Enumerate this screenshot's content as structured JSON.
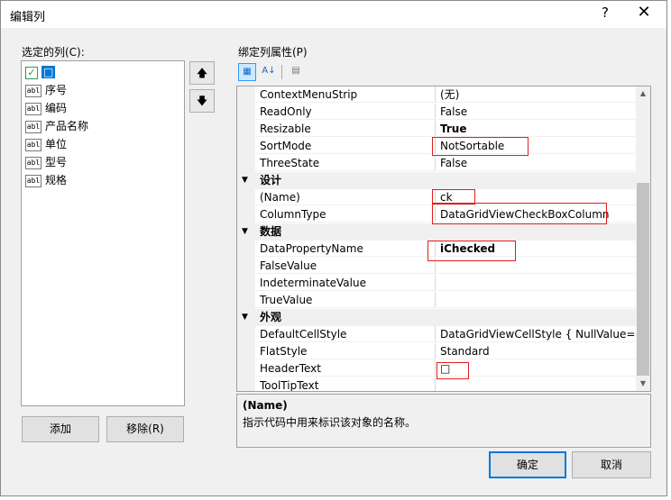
{
  "window": {
    "title": "编辑列",
    "help": "?",
    "close": "✕"
  },
  "columns": {
    "label": "选定的列(C):",
    "items": [
      {
        "icon": "✓",
        "label": "□",
        "selected": true
      },
      {
        "icon": "abl",
        "label": "序号"
      },
      {
        "icon": "abl",
        "label": "编码"
      },
      {
        "icon": "abl",
        "label": "产品名称"
      },
      {
        "icon": "abl",
        "label": "单位"
      },
      {
        "icon": "abl",
        "label": "型号"
      },
      {
        "icon": "abl",
        "label": "规格"
      }
    ],
    "up_icon": "🡅",
    "down_icon": "🡇",
    "add_label": "添加",
    "remove_label": "移除(R)"
  },
  "properties": {
    "label": "绑定列属性(P)",
    "toolbar": {
      "categorized_icon": "▦",
      "alpha_icon": "A↓",
      "pages_icon": "▤"
    },
    "rows": [
      {
        "name": "ContextMenuStrip",
        "value": "(无)"
      },
      {
        "name": "ReadOnly",
        "value": "False"
      },
      {
        "name": "Resizable",
        "value": "True",
        "bold": true
      },
      {
        "name": "SortMode",
        "value": "NotSortable"
      },
      {
        "name": "ThreeState",
        "value": "False"
      }
    ],
    "cat_design": "设计",
    "design_rows": [
      {
        "name": "(Name)",
        "value": "ck"
      },
      {
        "name": "ColumnType",
        "value": "DataGridViewCheckBoxColumn"
      }
    ],
    "cat_data": "数据",
    "data_rows": [
      {
        "name": "DataPropertyName",
        "value": "iChecked",
        "bold": true
      },
      {
        "name": "FalseValue",
        "value": ""
      },
      {
        "name": "IndeterminateValue",
        "value": ""
      },
      {
        "name": "TrueValue",
        "value": ""
      }
    ],
    "cat_appearance": "外观",
    "appearance_rows": [
      {
        "name": "DefaultCellStyle",
        "value": "DataGridViewCellStyle { NullValue=Fal"
      },
      {
        "name": "FlatStyle",
        "value": "Standard"
      },
      {
        "name": "HeaderText",
        "value": "□"
      },
      {
        "name": "ToolTipText",
        "value": ""
      }
    ],
    "collapse_icon": "▼"
  },
  "description": {
    "title": "(Name)",
    "text": "指示代码中用来标识该对象的名称。"
  },
  "buttons": {
    "ok": "确定",
    "cancel": "取消"
  },
  "scrollbar": {
    "up": "▲",
    "down": "▼"
  }
}
